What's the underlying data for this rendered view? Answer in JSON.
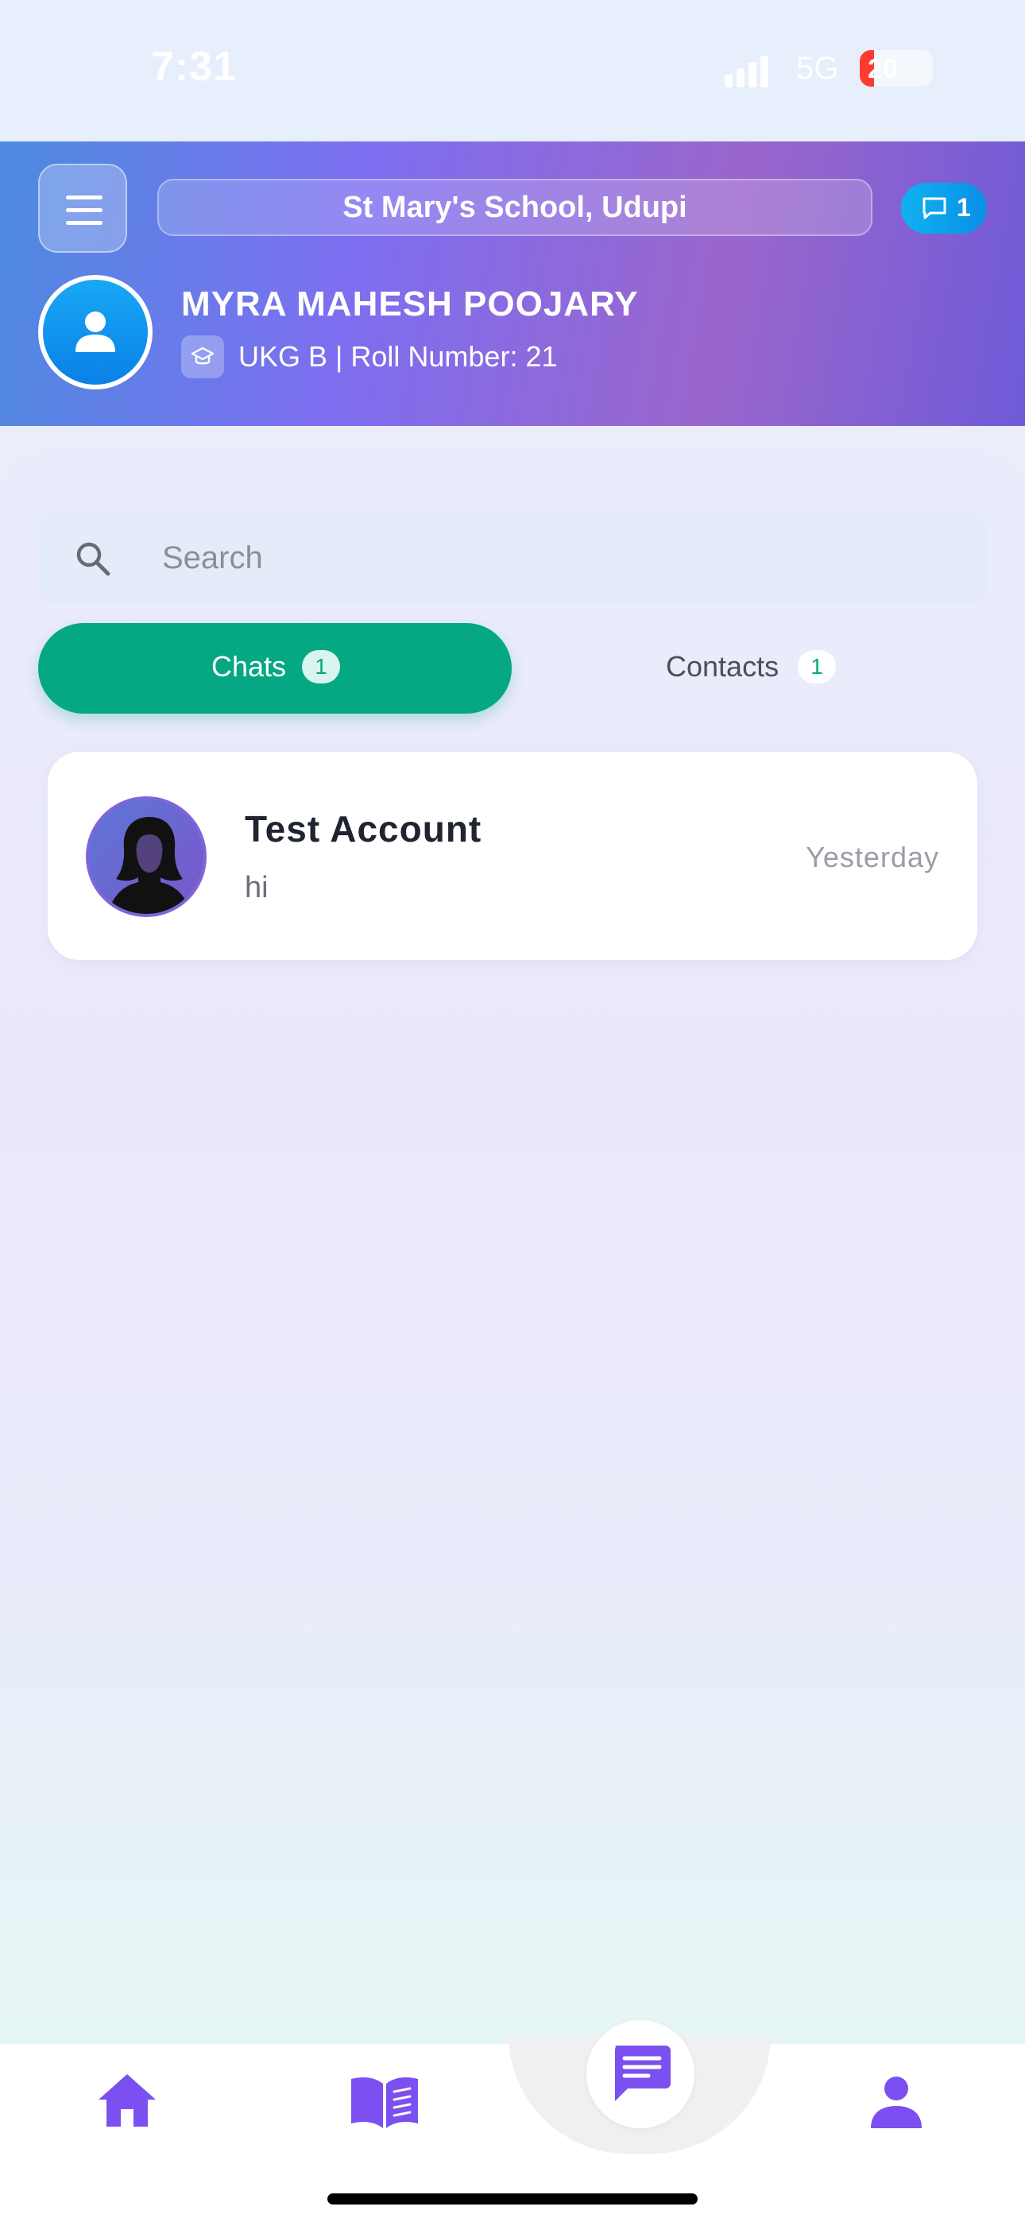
{
  "status_bar": {
    "time": "7:31",
    "network": "5G",
    "battery": "20",
    "battery_fraction": 0.2,
    "battery_color": "#ff3b30"
  },
  "header": {
    "menu_icon": "hamburger-menu-icon",
    "school_name": "St Mary's School, Udupi",
    "message_count": "1",
    "student_name": "MYRA MAHESH POOJARY",
    "class_info": "UKG B | Roll Number: 21",
    "class_icon": "graduation-cap-icon"
  },
  "search": {
    "placeholder": "Search",
    "value": ""
  },
  "tabs": [
    {
      "label": "Chats",
      "count": "1",
      "active": true
    },
    {
      "label": "Contacts",
      "count": "1",
      "active": false
    }
  ],
  "chats": [
    {
      "name": "Test Account",
      "preview": "hi",
      "time": "Yesterday",
      "avatar": "female-silhouette-avatar"
    }
  ],
  "bottom_nav": [
    {
      "name": "home",
      "icon": "home-icon"
    },
    {
      "name": "library",
      "icon": "book-icon"
    },
    {
      "name": "messages",
      "icon": "message-icon",
      "active": true
    },
    {
      "name": "profile",
      "icon": "person-icon"
    }
  ],
  "colors": {
    "accent_purple": "#7b4ff0",
    "accent_green": "#05a882",
    "header_start": "#4d8be0",
    "header_end": "#9a66cc"
  }
}
